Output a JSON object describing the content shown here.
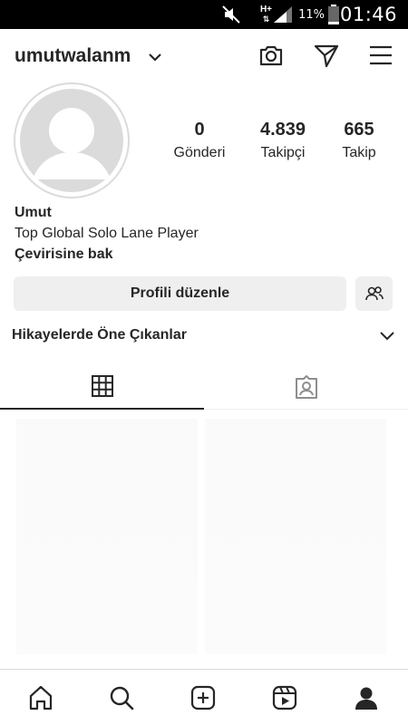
{
  "status_bar": {
    "network": "H+",
    "battery_percent": "11%",
    "time": "01:46"
  },
  "header": {
    "username": "umutwalanm",
    "icons": [
      "camera-icon",
      "direct-send-icon",
      "menu-icon"
    ]
  },
  "profile": {
    "stats": [
      {
        "value": "0",
        "label": "Gönderi"
      },
      {
        "value": "4.839",
        "label": "Takipçi"
      },
      {
        "value": "665",
        "label": "Takip"
      }
    ],
    "name": "Umut",
    "bio": "Top Global Solo Lane Player",
    "translate_label": "Çevirisine bak"
  },
  "actions": {
    "edit_profile_label": "Profili düzenle"
  },
  "highlights": {
    "title": "Hikayelerde Öne Çıkanlar"
  },
  "tabs": [
    {
      "icon": "grid-icon",
      "active": true
    },
    {
      "icon": "tagged-icon",
      "active": false
    }
  ],
  "bottom_nav": [
    "home-icon",
    "search-icon",
    "new-post-icon",
    "reels-icon",
    "profile-icon"
  ],
  "colors": {
    "text": "#262626",
    "button_bg": "#efefef",
    "divider": "#dbdbdb",
    "status_bar_bg": "#000000"
  }
}
